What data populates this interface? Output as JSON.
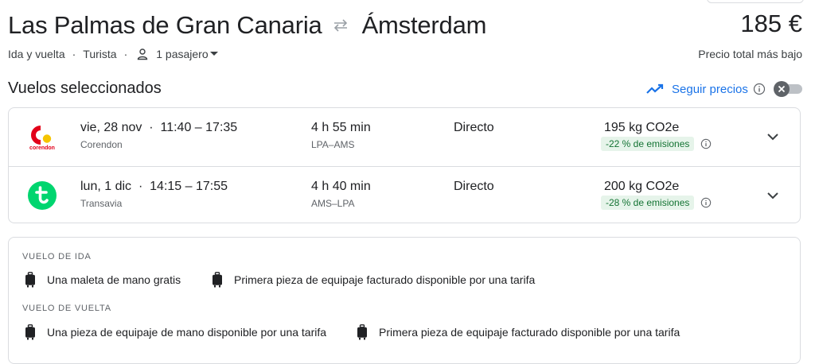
{
  "header": {
    "origin": "Las Palmas de Gran Canaria",
    "destination": "Ámsterdam",
    "swap_icon": "swap-arrows-icon",
    "price": "185 €",
    "price_note": "Precio total más bajo",
    "trip_type": "Ida y vuelta",
    "cabin": "Turista",
    "passengers": "1 pasajero"
  },
  "section_title": "Vuelos seleccionados",
  "track_prices": {
    "label": "Seguir precios",
    "icon": "trending-icon",
    "enabled": false
  },
  "flights": [
    {
      "airline": "Corendon",
      "logo_text": "corendon",
      "date": "vie, 28 nov",
      "times": "11:40 – 17:35",
      "duration": "4 h 55 min",
      "route": "LPA–AMS",
      "stops": "Directo",
      "co2": "195 kg CO2e",
      "emissions": "-22 % de emisiones"
    },
    {
      "airline": "Transavia",
      "date": "lun, 1 dic",
      "times": "14:15 – 17:55",
      "duration": "4 h 40 min",
      "route": "AMS–LPA",
      "stops": "Directo",
      "co2": "200 kg CO2e",
      "emissions": "-28 % de emisiones"
    }
  ],
  "baggage": {
    "outbound": {
      "title": "VUELO DE IDA",
      "items": [
        "Una maleta de mano gratis",
        "Primera pieza de equipaje facturado disponible por una tarifa"
      ]
    },
    "return": {
      "title": "VUELO DE VUELTA",
      "items": [
        "Una pieza de equipaje de mano disponible por una tarifa",
        "Primera pieza de equipaje facturado disponible por una tarifa"
      ]
    }
  },
  "colors": {
    "accent": "#1a73e8",
    "corendon_red": "#e2001a",
    "corendon_yellow": "#f5c400",
    "transavia_green": "#00d56f",
    "emission_bg": "#e6f4ea",
    "emission_text": "#137333"
  }
}
